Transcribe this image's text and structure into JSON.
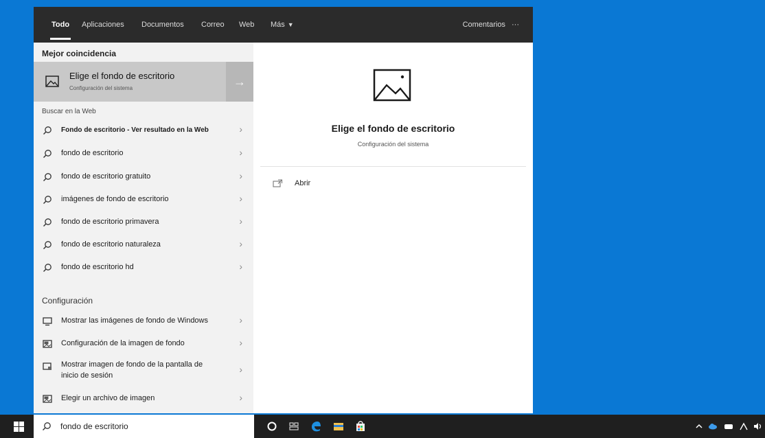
{
  "tabs": [
    {
      "label": "Todo",
      "active": true
    },
    {
      "label": "Aplicaciones",
      "active": false
    },
    {
      "label": "Documentos",
      "active": false
    },
    {
      "label": "Correo",
      "active": false
    },
    {
      "label": "Web",
      "active": false
    },
    {
      "label": "Más",
      "active": false
    }
  ],
  "feedback_label": "Comentarios",
  "more_options_label": "···",
  "sections": {
    "best_match": "Mejor coincidencia",
    "web": "Buscar en la Web",
    "settings": "Configuración"
  },
  "best_match": {
    "title": "Elige el fondo de escritorio",
    "subtitle": "Configuración del sistema",
    "arrow": "→"
  },
  "web_results": [
    {
      "label": "Fondo de escritorio - Ver resultado en la Web",
      "bold": true
    },
    {
      "label": "fondo de escritorio"
    },
    {
      "label": "fondo de escritorio gratuito"
    },
    {
      "label": "imágenes de fondo de escritorio"
    },
    {
      "label": "fondo de escritorio primavera"
    },
    {
      "label": "fondo de escritorio naturaleza"
    },
    {
      "label": "fondo de escritorio hd"
    }
  ],
  "settings_results": [
    {
      "label": "Mostrar las imágenes de fondo de Windows",
      "icon": "monitor-icon"
    },
    {
      "label": "Configuración de la imagen de fondo",
      "icon": "picture-settings-icon"
    },
    {
      "label": "Mostrar imagen de fondo de la pantalla de inicio de sesión",
      "icon": "lock-screen-icon"
    },
    {
      "label": "Elegir un archivo de imagen",
      "icon": "picture-settings-icon"
    }
  ],
  "chevron": "›",
  "preview": {
    "title": "Elige el fondo de escritorio",
    "subtitle": "Configuración del sistema",
    "action_label": "Abrir"
  },
  "taskbar": {
    "search_text": "fondo de escritorio"
  },
  "colors": {
    "desktop": "#0a78d4",
    "topbar": "#2b2b2b",
    "highlight": "#c8c8c8",
    "edge_blue": "#1e90e0",
    "explorer_yellow": "#f2c14e"
  }
}
